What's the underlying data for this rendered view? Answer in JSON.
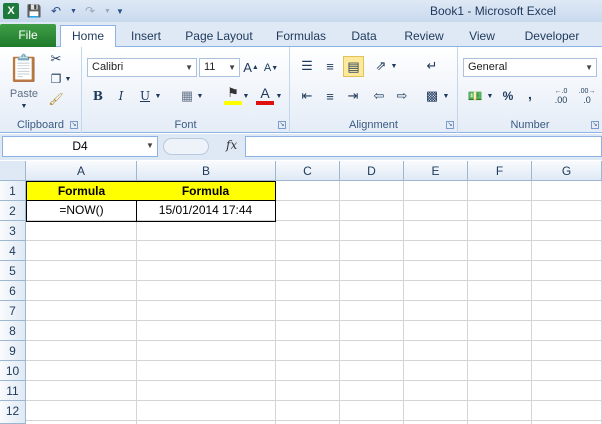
{
  "window": {
    "title": "Book1 - Microsoft Excel"
  },
  "qat": {
    "save_icon": "save-icon",
    "undo_icon": "undo-icon",
    "redo_icon": "redo-icon"
  },
  "tabs": {
    "file": "File",
    "items": [
      "Home",
      "Insert",
      "Page Layout",
      "Formulas",
      "Data",
      "Review",
      "View",
      "Developer"
    ],
    "active": "Home"
  },
  "ribbon": {
    "clipboard": {
      "label": "Clipboard",
      "paste": "Paste"
    },
    "font": {
      "label": "Font",
      "name": "Calibri",
      "size": "11",
      "bold": "B",
      "italic": "I",
      "underline": "U",
      "grow": "A",
      "shrink": "A",
      "font_color": "A"
    },
    "alignment": {
      "label": "Alignment"
    },
    "number": {
      "label": "Number",
      "format": "General",
      "percent": "%",
      "comma": ",",
      "inc_decimal": ".00",
      "dec_decimal": ".0"
    }
  },
  "formula_bar": {
    "name_box": "D4",
    "fx": "fx",
    "content": ""
  },
  "columns": [
    "A",
    "B",
    "C",
    "D",
    "E",
    "F",
    "G"
  ],
  "rows": [
    "1",
    "2",
    "3",
    "4",
    "5",
    "6",
    "7",
    "8",
    "9",
    "10",
    "11",
    "12"
  ],
  "cells": {
    "A1": "Formula",
    "B1": "Formula",
    "A2": "=NOW()",
    "B2": "15/01/2014 17:44"
  },
  "colors": {
    "header_fill": "#ffff00",
    "file_tab": "#207a2b",
    "accent": "#8db2e3"
  }
}
